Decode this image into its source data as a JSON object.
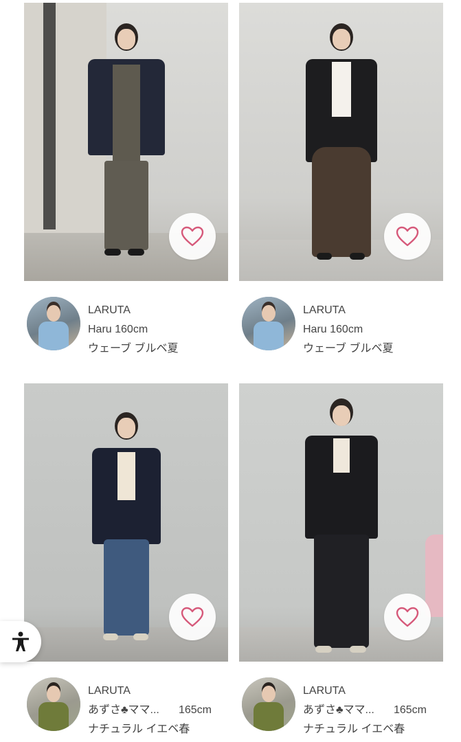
{
  "posts": [
    {
      "brand": "LARUTA",
      "user": "Haru 160cm",
      "user_name": "Haru",
      "height": "160cm",
      "type": "ウェーブ ブルベ夏",
      "like_icon": "heart-outline-icon"
    },
    {
      "brand": "LARUTA",
      "user": "Haru 160cm",
      "user_name": "Haru",
      "height": "160cm",
      "type": "ウェーブ ブルベ夏",
      "like_icon": "heart-outline-icon"
    },
    {
      "brand": "LARUTA",
      "user_name": "あずさ♣ママ...",
      "height": "165cm",
      "type": "ナチュラル イエベ春",
      "like_icon": "heart-outline-icon"
    },
    {
      "brand": "LARUTA",
      "user_name": "あずさ♣ママ...",
      "height": "165cm",
      "type": "ナチュラル イエベ春",
      "like_icon": "heart-outline-icon"
    }
  ],
  "colors": {
    "heart": "#d6597a",
    "text": "#444444",
    "background": "#ffffff"
  },
  "accessibility": {
    "icon": "accessibility-person-icon"
  }
}
